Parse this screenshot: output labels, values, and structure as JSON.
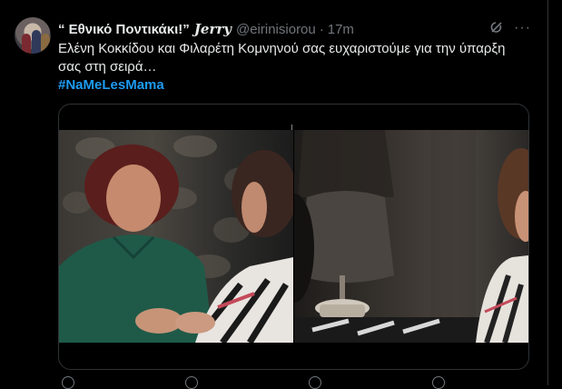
{
  "tweet": {
    "display_name": "“ Εθνικό Ποντικάκι!”",
    "display_name_fancy": "Jerry",
    "handle": "@eirinisiorou",
    "separator": "·",
    "timestamp": "17m",
    "text": "Ελένη Κοκκίδου και Φιλαρέτη Κομνηνού σας ευχαριστούμε για την ύπαρξη σας στη σειρά…",
    "hashtag": "#NaMeLesMama",
    "more_label": "···",
    "icons": {
      "grok": "grok-icon",
      "more": "more-options-icon"
    }
  },
  "colors": {
    "background": "#000000",
    "text": "#e7e9ea",
    "secondary": "#71767b",
    "link": "#1d9bf0",
    "border": "#2f3336"
  }
}
